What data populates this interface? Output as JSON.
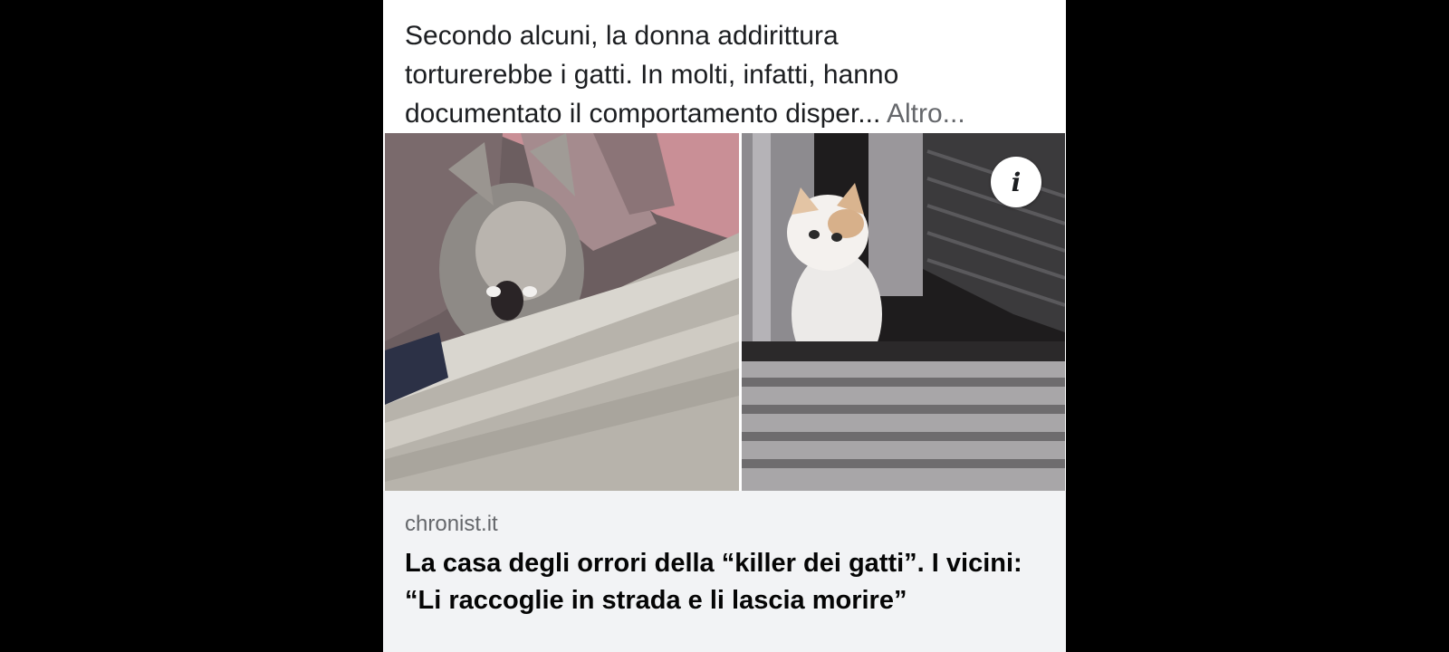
{
  "post": {
    "caption_lines": [
      "Secondo alcuni, la donna addirittura",
      "torturerebbe i gatti. In molti, infatti, hanno",
      "documentato il comportamento disper..."
    ],
    "more_label": "Altro..."
  },
  "media": {
    "left_photo": "cat-at-window-photo",
    "right_photo": "white-kitten-at-window-photo",
    "info_icon": "i"
  },
  "link_preview": {
    "domain": "chronist.it",
    "headline": "La casa degli orrori della “killer dei gatti”. I vicini: “Li raccoglie in strada e li lascia morire”"
  },
  "colors": {
    "background": "#000000",
    "card": "#ffffff",
    "preview_bg": "#f2f3f5",
    "muted_text": "#65676b",
    "text": "#1c1e21"
  }
}
